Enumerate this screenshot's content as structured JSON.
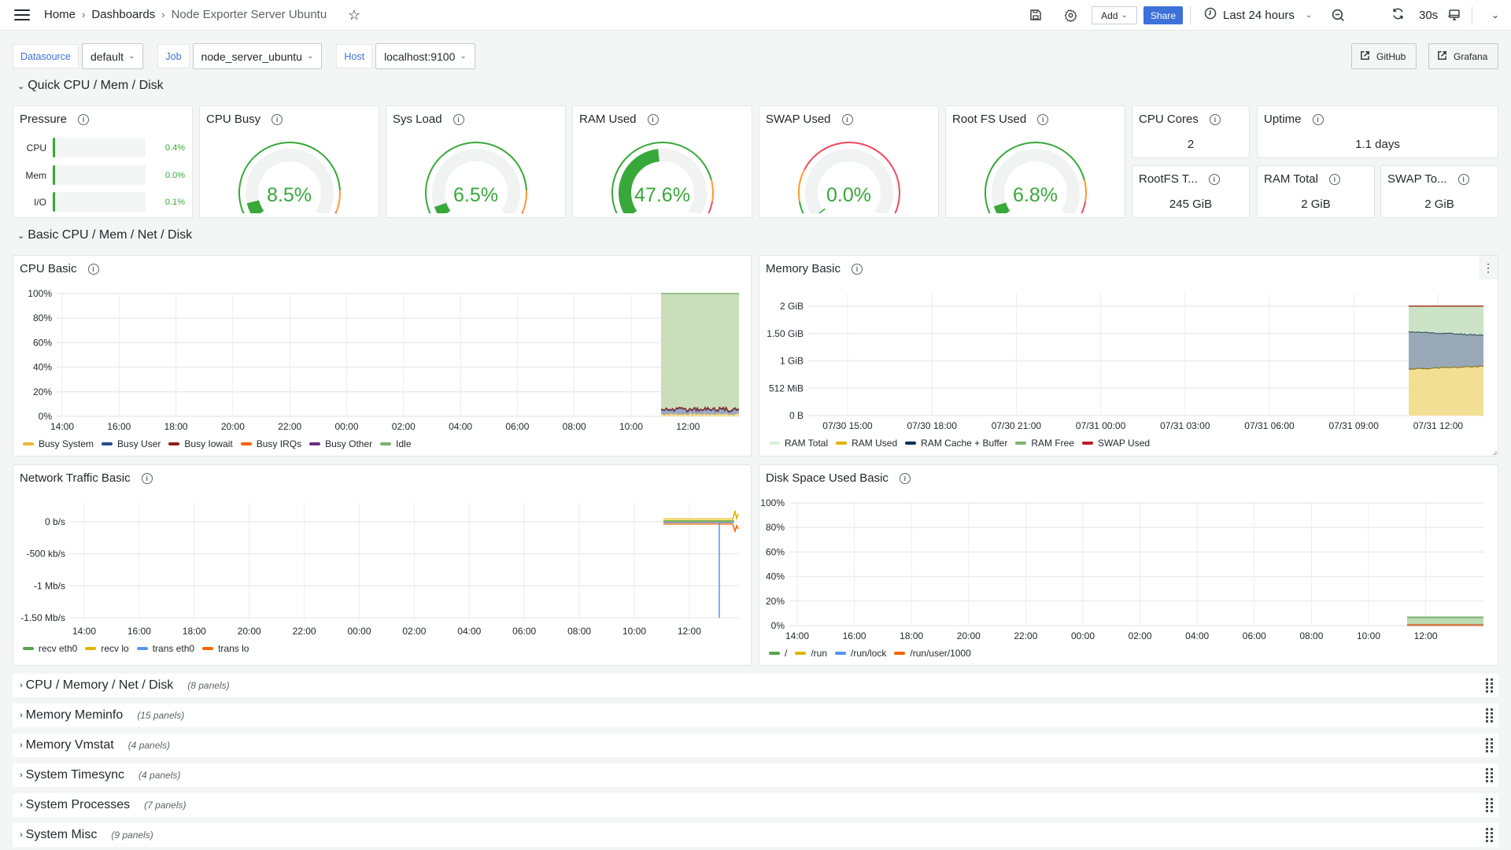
{
  "topbar": {
    "breadcrumbs": [
      "Home",
      "Dashboards",
      "Node Exporter Server Ubuntu"
    ],
    "add_label": "Add",
    "share_label": "Share",
    "time_range": "Last 24 hours",
    "refresh_interval": "30s",
    "icons": [
      "menu-icon",
      "star-icon",
      "save-icon",
      "gear-icon",
      "clock-icon",
      "zoom-out-icon",
      "refresh-icon",
      "tv-icon"
    ]
  },
  "filters": [
    {
      "label": "Datasource",
      "value": "default"
    },
    {
      "label": "Job",
      "value": "node_server_ubuntu"
    },
    {
      "label": "Host",
      "value": "localhost:9100"
    }
  ],
  "links": [
    {
      "label": "GitHub",
      "icon": "external-link-icon"
    },
    {
      "label": "Grafana",
      "icon": "external-link-icon"
    }
  ],
  "sections": {
    "quick": "Quick CPU / Mem / Disk",
    "basic": "Basic CPU / Mem / Net / Disk"
  },
  "pressure": {
    "title": "Pressure",
    "rows": [
      {
        "label": "CPU",
        "value": "0.4%",
        "fraction": 0.004
      },
      {
        "label": "Mem",
        "value": "0.0%",
        "fraction": 0.0
      },
      {
        "label": "I/O",
        "value": "0.1%",
        "fraction": 0.001
      }
    ]
  },
  "gauges": [
    {
      "title": "CPU Busy",
      "value": "8.5%",
      "percent": 8.5,
      "thresholds": [
        85,
        95
      ]
    },
    {
      "title": "Sys Load",
      "value": "6.5%",
      "percent": 6.5,
      "thresholds": [
        85,
        95
      ]
    },
    {
      "title": "RAM Used",
      "value": "47.6%",
      "percent": 47.6,
      "thresholds": [
        80,
        90
      ]
    },
    {
      "title": "SWAP Used",
      "value": "0.0%",
      "percent": 0.0,
      "thresholds": [
        10,
        25
      ]
    },
    {
      "title": "Root FS Used",
      "value": "6.8%",
      "percent": 6.8,
      "thresholds": [
        80,
        90
      ]
    }
  ],
  "stats": [
    {
      "title": "CPU Cores",
      "value": "2"
    },
    {
      "title": "Uptime",
      "value": "1.1 days"
    },
    {
      "title": "RootFS T...",
      "value": "245 GiB"
    },
    {
      "title": "RAM Total",
      "value": "2 GiB"
    },
    {
      "title": "SWAP To...",
      "value": "2 GiB"
    }
  ],
  "colors": {
    "green": "#37a839",
    "orange": "#ff9830",
    "red": "#f2495c",
    "accent": "#3d71d9"
  },
  "chart_data": [
    {
      "id": "cpu",
      "title": "CPU Basic",
      "type": "area",
      "stacked": true,
      "x": [
        "14:00",
        "16:00",
        "18:00",
        "20:00",
        "22:00",
        "00:00",
        "02:00",
        "04:00",
        "06:00",
        "08:00",
        "10:00",
        "12:00"
      ],
      "x_range_hours": [
        13.3,
        37.6
      ],
      "data_start_hour": 35.0,
      "yticks": [
        "0%",
        "20%",
        "40%",
        "60%",
        "80%",
        "100%"
      ],
      "ylim": [
        0,
        100
      ],
      "series": [
        {
          "name": "Busy System",
          "color": "#eab839",
          "mean": 2
        },
        {
          "name": "Busy User",
          "color": "#1f4e8c",
          "mean": 3.5
        },
        {
          "name": "Busy Iowait",
          "color": "#8f1d1d",
          "mean": 0.5
        },
        {
          "name": "Busy IRQs",
          "color": "#fa6400",
          "mean": 0
        },
        {
          "name": "Busy Other",
          "color": "#6f2c7b",
          "mean": 0
        },
        {
          "name": "Idle",
          "color": "#7eb26d",
          "mean": 94
        }
      ]
    },
    {
      "id": "mem",
      "title": "Memory Basic",
      "type": "area",
      "stacked": true,
      "x": [
        "07/30 15:00",
        "07/30 18:00",
        "07/30 21:00",
        "07/31 00:00",
        "07/31 03:00",
        "07/31 06:00",
        "07/31 09:00",
        "07/31 12:00"
      ],
      "yticks": [
        "0 B",
        "512 MiB",
        "1 GiB",
        "1.50 GiB",
        "2 GiB"
      ],
      "ylim_gib": [
        0,
        2.2
      ],
      "series": [
        {
          "name": "RAM Total",
          "color": "#d9f2d9",
          "value_gib": 2.0
        },
        {
          "name": "RAM Used",
          "color": "#e0b400",
          "value_gib": 0.86
        },
        {
          "name": "RAM Cache + Buffer",
          "color": "#0a2e5c",
          "value_gib": 0.63
        },
        {
          "name": "RAM Free",
          "color": "#7eb26d",
          "value_gib": 0.51
        },
        {
          "name": "SWAP Used",
          "color": "#c4162a",
          "value_gib": 0.0
        }
      ]
    },
    {
      "id": "net",
      "title": "Network Traffic Basic",
      "type": "line",
      "x": [
        "14:00",
        "16:00",
        "18:00",
        "20:00",
        "22:00",
        "00:00",
        "02:00",
        "04:00",
        "06:00",
        "08:00",
        "10:00",
        "12:00"
      ],
      "yticks": [
        "-1.50 Mb/s",
        "-1 Mb/s",
        "-500 kb/s",
        "0 b/s"
      ],
      "ylim_kbps": [
        -1750,
        250
      ],
      "series": [
        {
          "name": "recv eth0",
          "color": "#56a64b"
        },
        {
          "name": "recv lo",
          "color": "#e0b400"
        },
        {
          "name": "trans eth0",
          "color": "#5794f2"
        },
        {
          "name": "trans lo",
          "color": "#fa6400"
        }
      ],
      "spike": {
        "series": "trans eth0",
        "time": "13:00",
        "value_kbps": -1500
      }
    },
    {
      "id": "disk",
      "title": "Disk Space Used Basic",
      "type": "area",
      "x": [
        "14:00",
        "16:00",
        "18:00",
        "20:00",
        "22:00",
        "00:00",
        "02:00",
        "04:00",
        "06:00",
        "08:00",
        "10:00",
        "12:00"
      ],
      "yticks": [
        "0%",
        "20%",
        "40%",
        "60%",
        "80%",
        "100%"
      ],
      "ylim": [
        0,
        100
      ],
      "series": [
        {
          "name": "/",
          "color": "#56a64b",
          "value": 6.8
        },
        {
          "name": "/run",
          "color": "#e0b400",
          "value": 0.3
        },
        {
          "name": "/run/lock",
          "color": "#5794f2",
          "value": 0
        },
        {
          "name": "/run/user/1000",
          "color": "#fa6400",
          "value": 0.1
        }
      ]
    }
  ],
  "collapsed_rows": [
    {
      "title": "CPU / Memory / Net / Disk",
      "count": "(8 panels)"
    },
    {
      "title": "Memory Meminfo",
      "count": "(15 panels)"
    },
    {
      "title": "Memory Vmstat",
      "count": "(4 panels)"
    },
    {
      "title": "System Timesync",
      "count": "(4 panels)"
    },
    {
      "title": "System Processes",
      "count": "(7 panels)"
    },
    {
      "title": "System Misc",
      "count": "(9 panels)"
    }
  ]
}
